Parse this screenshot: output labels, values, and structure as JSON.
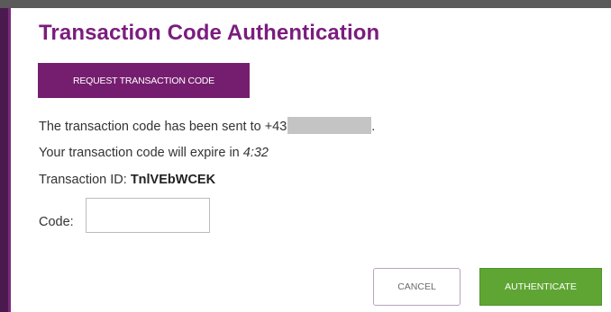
{
  "dialog": {
    "title": "Transaction Code Authentication",
    "request_button_label": "REQUEST TRANSACTION CODE",
    "sent_prefix": "The transaction code has been sent to +43",
    "sent_suffix": ".",
    "expire_prefix": "Your transaction code will expire in ",
    "expire_time": "4:32",
    "transaction_id_label": "Transaction ID: ",
    "transaction_id_value": "TnlVEbWCEK",
    "code_label": "Code:",
    "code_value": "",
    "cancel_label": "CANCEL",
    "authenticate_label": "AUTHENTICATE"
  },
  "colors": {
    "brand_purple": "#7b1c7f",
    "button_purple": "#751e6f",
    "authenticate_green": "#5fa533",
    "redaction_gray": "#c4c4c4"
  }
}
